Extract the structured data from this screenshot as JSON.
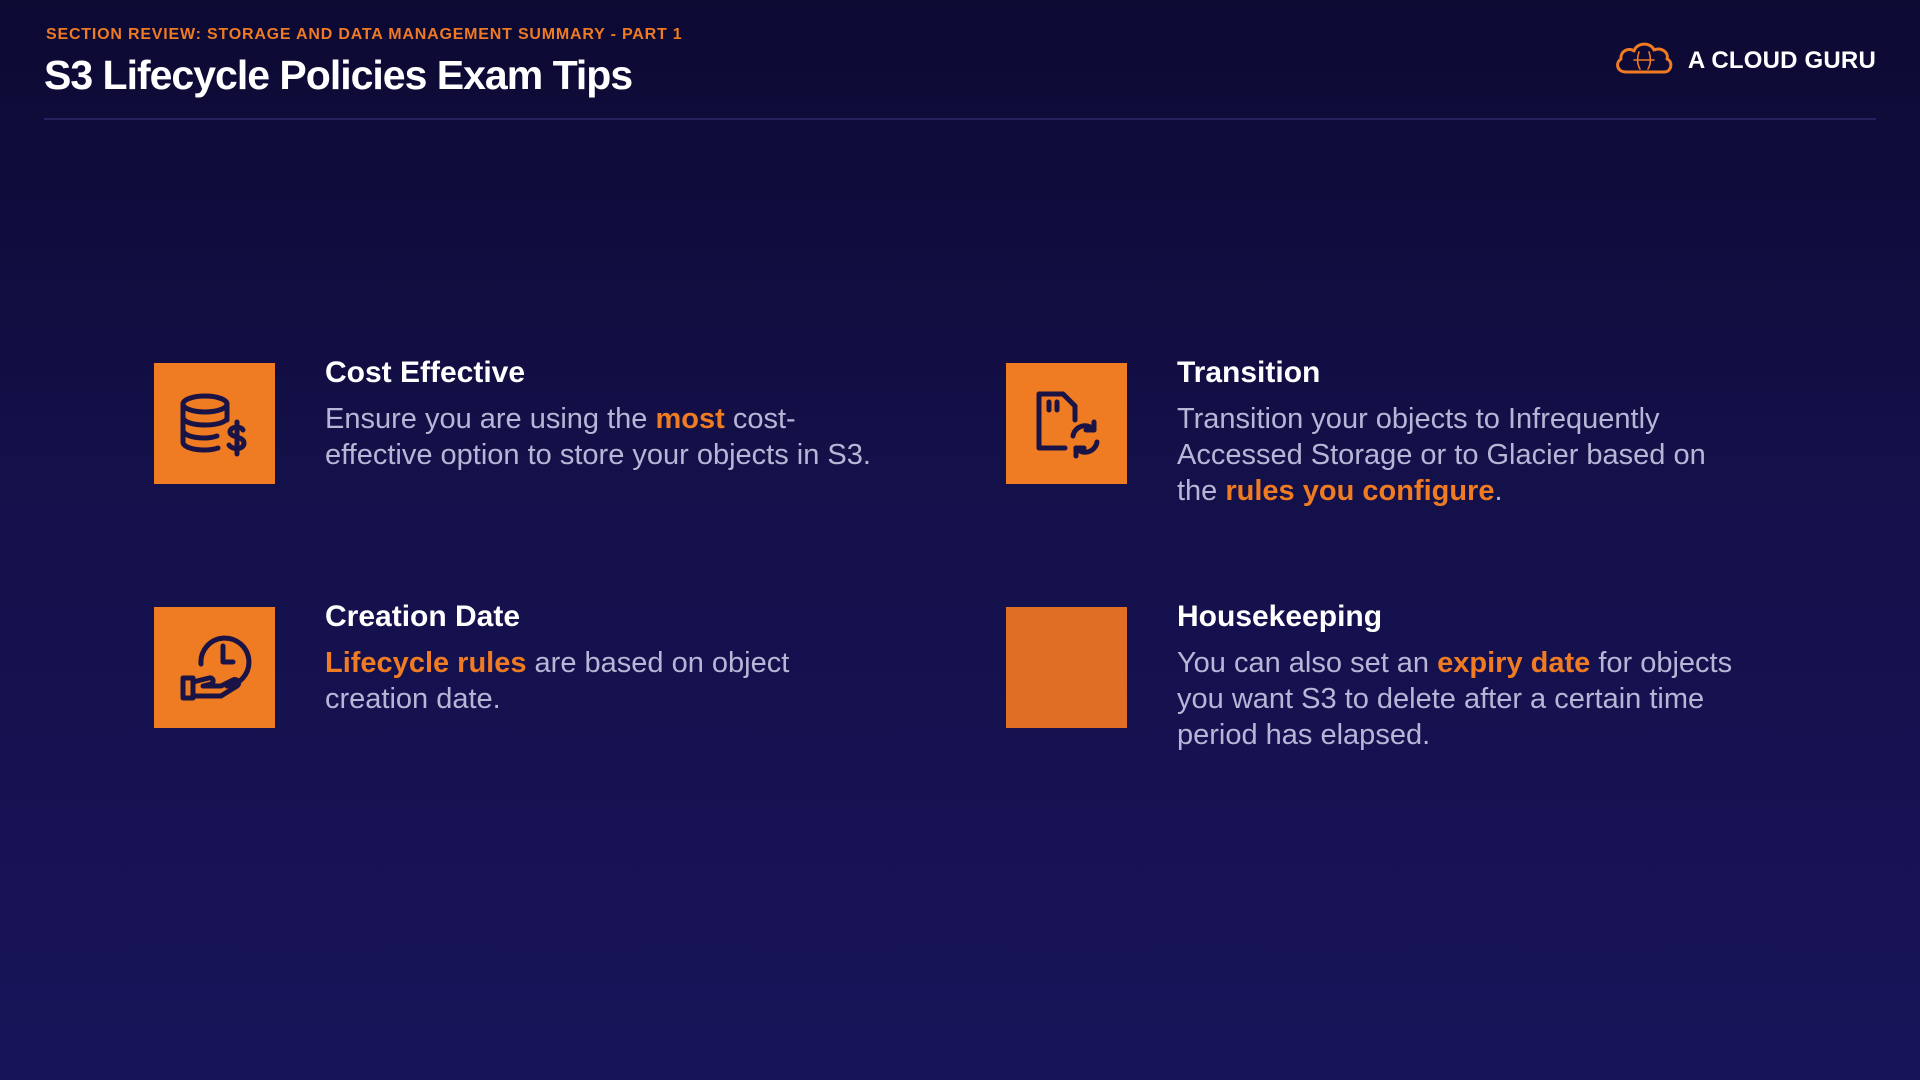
{
  "header": {
    "section_label": "SECTION REVIEW: STORAGE AND DATA MANAGEMENT SUMMARY - PART 1",
    "title": "S3 Lifecycle Policies Exam Tips",
    "brand_name": "A CLOUD GURU",
    "brand_icon": "cloud-logo-icon"
  },
  "colors": {
    "accent": "#ef7b22",
    "background": "#14104a",
    "body_text": "#b8b6d6"
  },
  "cards": [
    {
      "icon": "database-dollar-icon",
      "title": "Cost Effective",
      "body": {
        "pre": "Ensure you are using the ",
        "highlight": "most",
        "post": " cost-effective option to store your objects in S3."
      }
    },
    {
      "icon": "file-sync-icon",
      "title": "Transition",
      "body": {
        "pre": "Transition your objects to Infrequently Accessed Storage or to Glacier based on the ",
        "highlight": "rules you configure",
        "post": "."
      }
    },
    {
      "icon": "clock-hand-icon",
      "title": "Creation Date",
      "body": {
        "pre": "",
        "highlight": "Lifecycle rules",
        "post": " are based on object creation date."
      }
    },
    {
      "icon": "blank-icon",
      "title": "Housekeeping",
      "body": {
        "pre": "You can also set an ",
        "highlight": "expiry date",
        "post": " for objects you want S3 to delete after a certain time period has elapsed."
      }
    }
  ]
}
